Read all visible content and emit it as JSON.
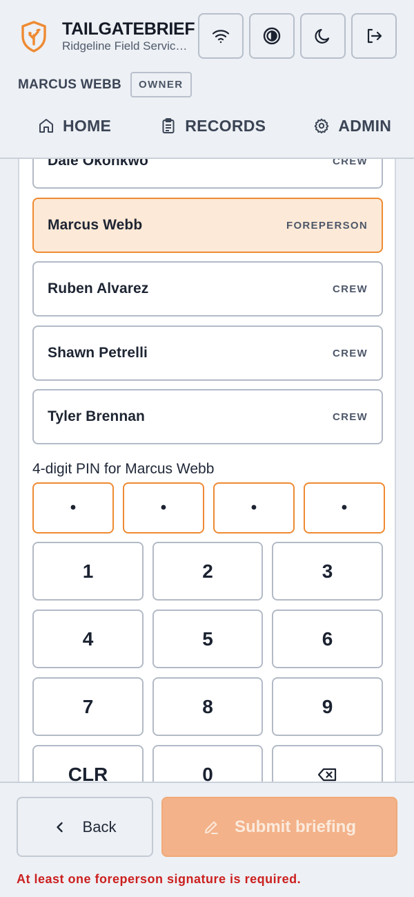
{
  "app": {
    "title": "TAILGATEBRIEF",
    "subtitle": "Ridgeline Field Services",
    "accent": "#ee8a32"
  },
  "header_actions": [
    {
      "icon": "wifi-icon"
    },
    {
      "icon": "contrast-icon"
    },
    {
      "icon": "moon-icon"
    },
    {
      "icon": "logout-icon"
    }
  ],
  "user": {
    "name": "MARCUS WEBB",
    "role": "OWNER"
  },
  "nav": [
    {
      "label": "HOME",
      "icon": "home-icon"
    },
    {
      "label": "RECORDS",
      "icon": "clipboard-icon"
    },
    {
      "label": "ADMIN",
      "icon": "gear-icon"
    }
  ],
  "crew_list": [
    {
      "name": "Dale Okonkwo",
      "role": "CREW",
      "selected": false
    },
    {
      "name": "Marcus Webb",
      "role": "FOREPERSON",
      "selected": true
    },
    {
      "name": "Ruben Alvarez",
      "role": "CREW",
      "selected": false
    },
    {
      "name": "Shawn Petrelli",
      "role": "CREW",
      "selected": false
    },
    {
      "name": "Tyler Brennan",
      "role": "CREW",
      "selected": false
    }
  ],
  "pin": {
    "label": "4-digit PIN for Marcus Webb",
    "digits": [
      "•",
      "•",
      "•",
      "•"
    ]
  },
  "keypad": [
    "1",
    "2",
    "3",
    "4",
    "5",
    "6",
    "7",
    "8",
    "9",
    "CLR",
    "0",
    "backspace"
  ],
  "footer": {
    "back_label": "Back",
    "submit_label": "Submit briefing",
    "error": "At least one foreperson signature is required."
  }
}
